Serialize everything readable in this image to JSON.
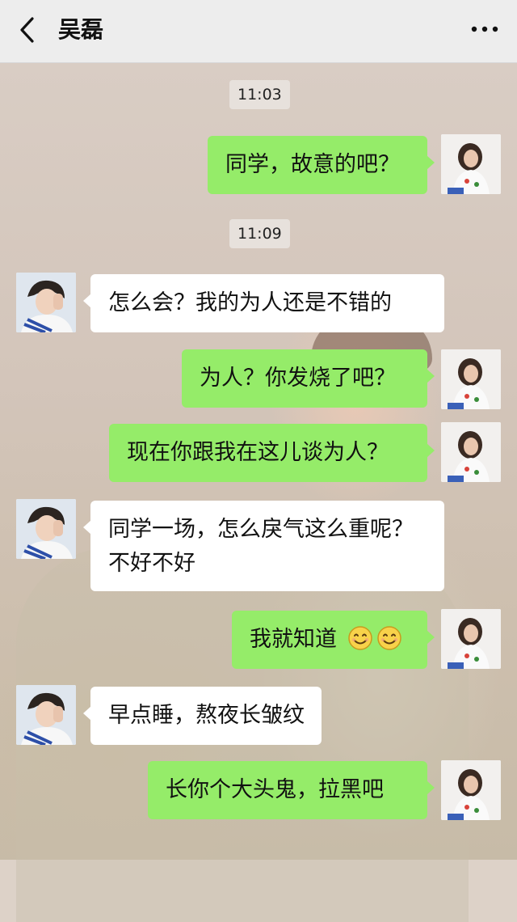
{
  "header": {
    "title": "吴磊"
  },
  "timestamps": [
    "11:03",
    "11:09"
  ],
  "messages": [
    {
      "side": "sent",
      "text": "同学，故意的吧？"
    },
    {
      "side": "recv",
      "text": "怎么会？我的为人还是不错的"
    },
    {
      "side": "sent",
      "text": "为人？你发烧了吧？"
    },
    {
      "side": "sent",
      "text": "现在你跟我在这儿谈为人？"
    },
    {
      "side": "recv",
      "line1": "同学一场，怎么戾气这么重呢？",
      "line2": "不好不好"
    },
    {
      "side": "sent",
      "text": "我就知道",
      "emoji": [
        "smile-emoji",
        "smile-emoji"
      ]
    },
    {
      "side": "recv",
      "text": "早点睡，熬夜长皱纹"
    },
    {
      "side": "sent",
      "text": "长你个大头鬼，拉黑吧"
    }
  ],
  "icons": {
    "back": "chevron-left-icon",
    "more": "more-dots-icon"
  },
  "colors": {
    "sent_bubble": "#95ec69",
    "recv_bubble": "#ffffff",
    "header_bg": "#ededed"
  }
}
